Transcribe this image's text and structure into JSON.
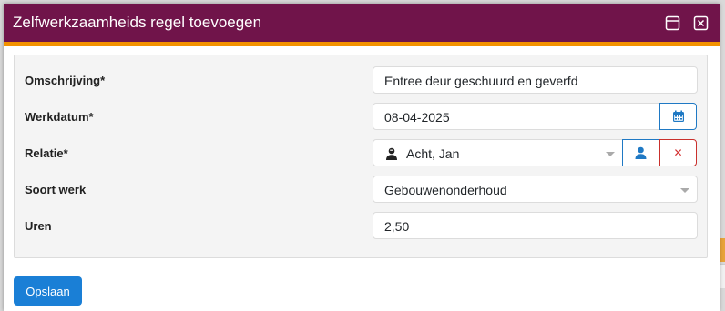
{
  "dialog": {
    "title": "Zelfwerkzaamheids regel toevoegen",
    "icons": [
      "maximize-icon",
      "close-icon"
    ]
  },
  "form": {
    "omschrijving": {
      "label": "Omschrijving*",
      "value": "Entree deur geschuurd en geverfd"
    },
    "werkdatum": {
      "label": "Werkdatum*",
      "value": "08-04-2025"
    },
    "relatie": {
      "label": "Relatie*",
      "value": "Acht, Jan"
    },
    "soort_werk": {
      "label": "Soort werk",
      "value": "Gebouwenonderhoud"
    },
    "uren": {
      "label": "Uren",
      "value": "2,50"
    },
    "clear_symbol": "✕"
  },
  "footer": {
    "save_label": "Opslaan"
  },
  "colors": {
    "header": "#70144a",
    "accent": "#f39200",
    "primary": "#1a7fd6",
    "danger": "#d32f2f"
  }
}
